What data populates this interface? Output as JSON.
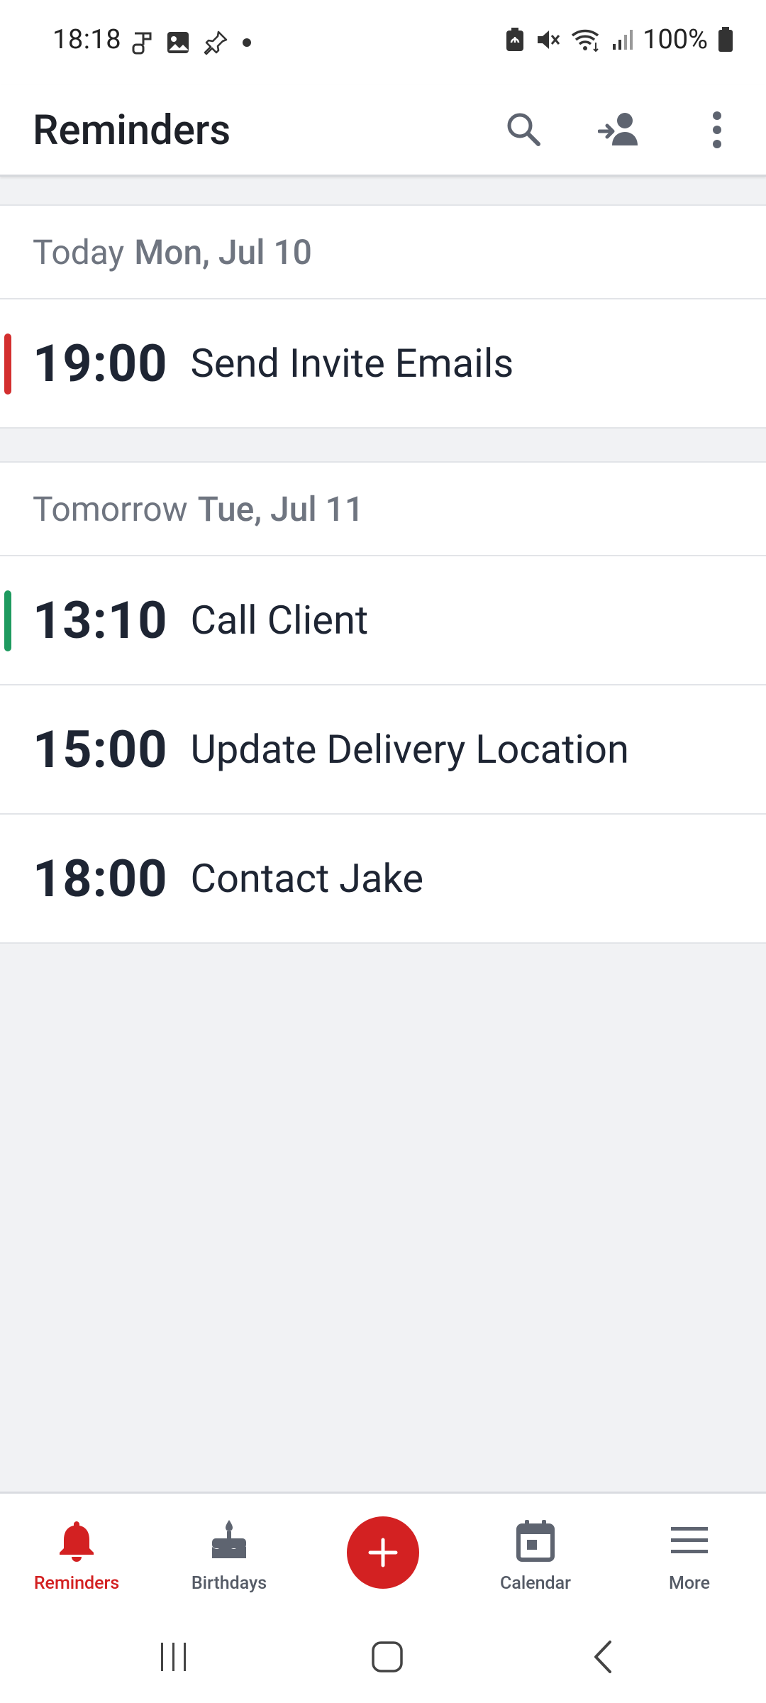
{
  "status_bar": {
    "time": "18:18",
    "battery": "100%",
    "left_icons": [
      "music-icon",
      "gallery-icon",
      "pin-icon",
      "dot-icon"
    ],
    "right_icons": [
      "battery-saver-icon",
      "mute-icon",
      "wifi-icon",
      "signal-icon",
      "battery-icon"
    ]
  },
  "app_bar": {
    "title": "Reminders",
    "actions": [
      "search-icon",
      "share-contact-icon",
      "more-vert-icon"
    ]
  },
  "sections": [
    {
      "relative": "Today",
      "date": "Mon, Jul 10",
      "reminders": [
        {
          "time": "19:00",
          "title": "Send Invite Emails",
          "color": "#d32f2f"
        }
      ]
    },
    {
      "relative": "Tomorrow",
      "date": "Tue, Jul 11",
      "reminders": [
        {
          "time": "13:10",
          "title": "Call Client",
          "color": "#1e9a5f"
        },
        {
          "time": "15:00",
          "title": "Update Delivery Location",
          "color": ""
        },
        {
          "time": "18:00",
          "title": "Contact Jake",
          "color": ""
        }
      ]
    }
  ],
  "bottom_nav": {
    "items": [
      {
        "label": "Reminders",
        "icon": "bell-icon",
        "active": true
      },
      {
        "label": "Birthdays",
        "icon": "cake-icon",
        "active": false
      },
      {
        "label": "Calendar",
        "icon": "calendar-icon",
        "active": false
      },
      {
        "label": "More",
        "icon": "menu-icon",
        "active": false
      }
    ],
    "fab_icon": "plus-icon"
  },
  "colors": {
    "accent": "#d32122",
    "text": "#1e2533",
    "muted": "#6f7580",
    "background": "#f1f2f4"
  },
  "system_nav": [
    "recents-icon",
    "home-icon",
    "back-icon"
  ]
}
